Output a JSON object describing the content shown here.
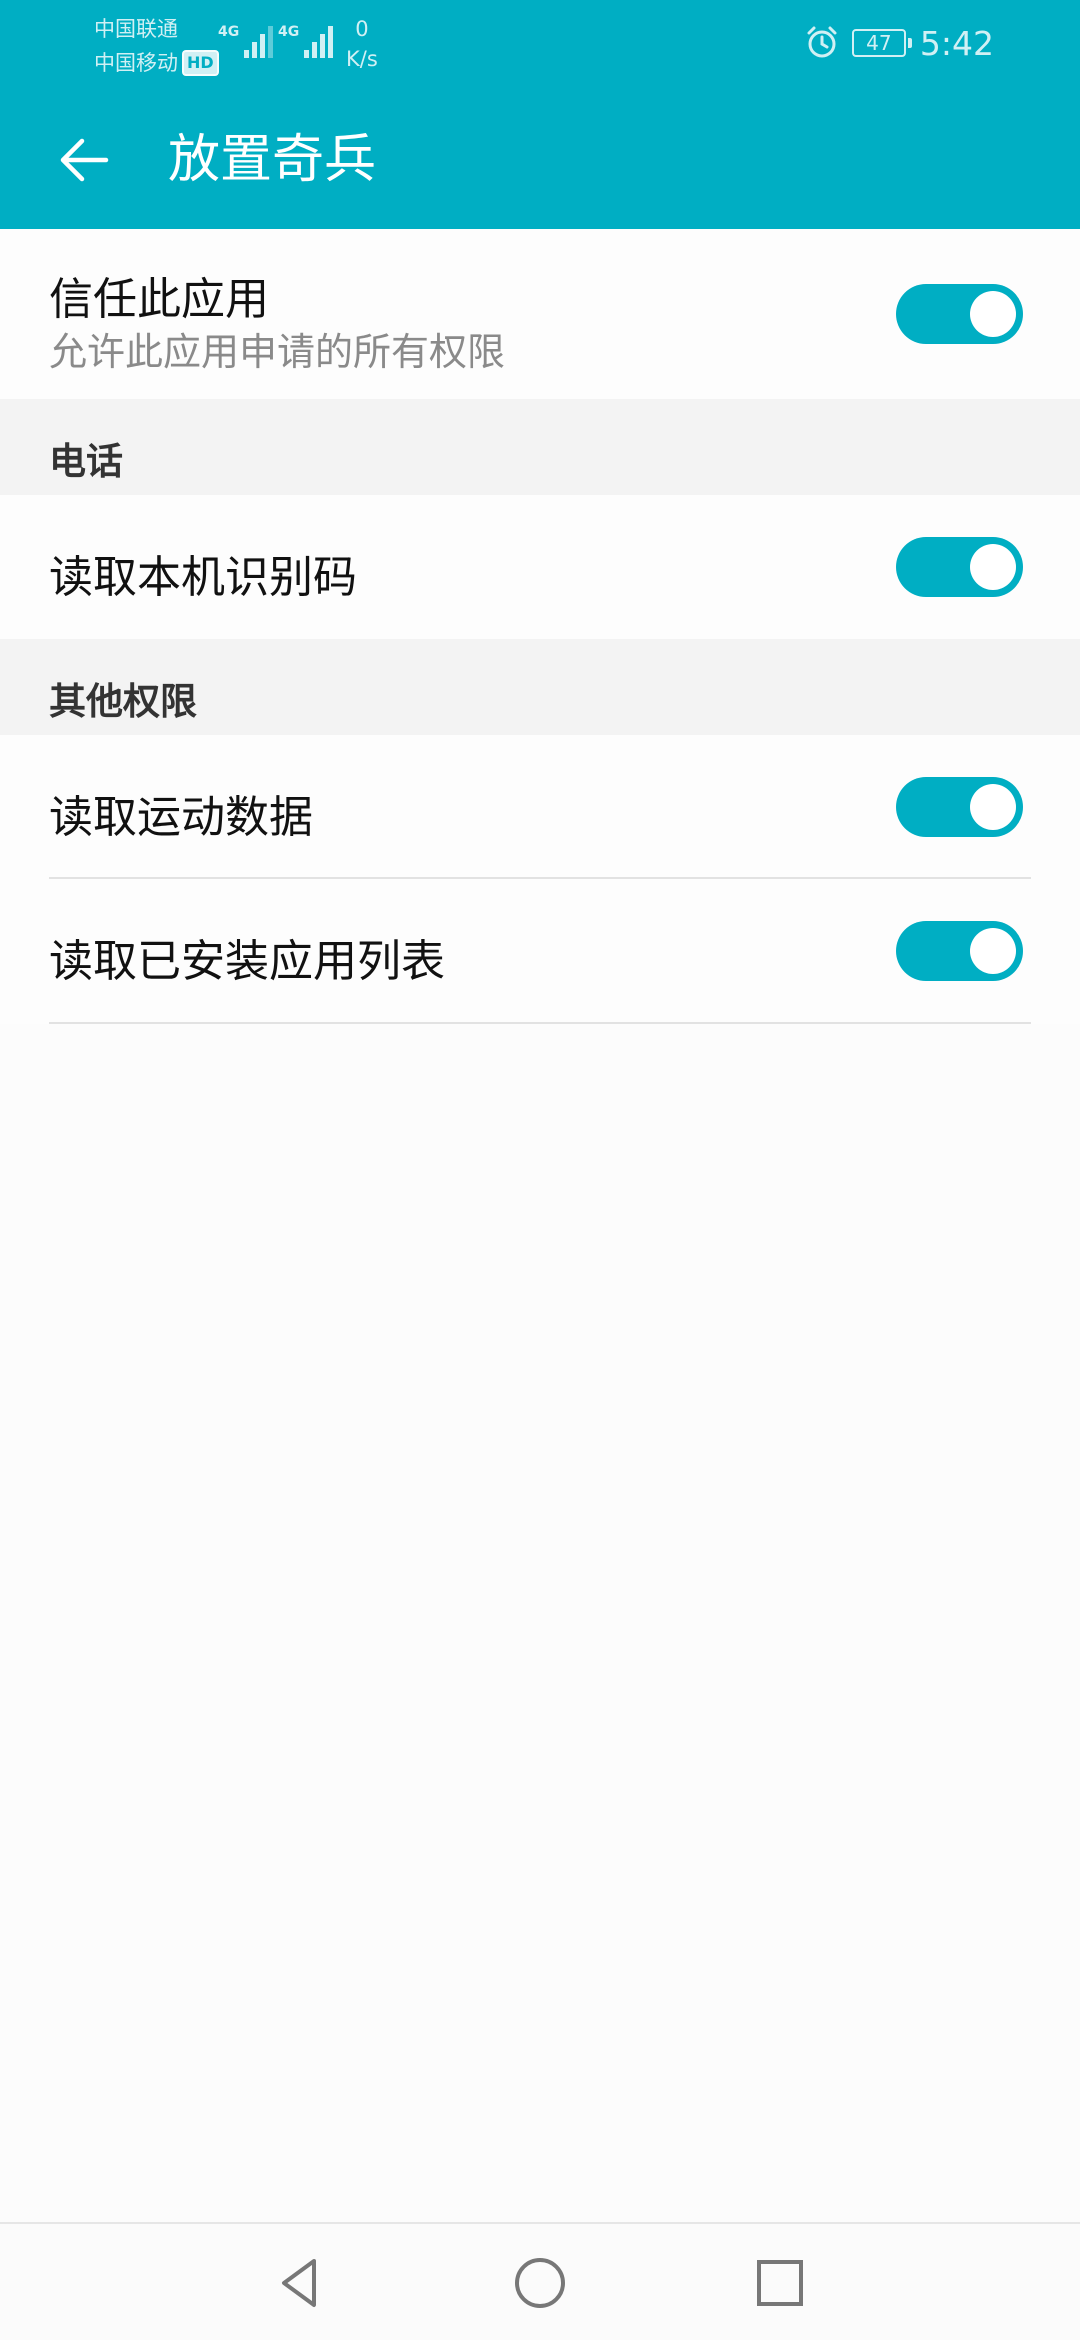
{
  "status_bar": {
    "carrier1": "中国联通",
    "carrier2": "中国移动",
    "hd_badge": "HD",
    "net1": "4G",
    "net2": "4G",
    "speed_value": "0",
    "speed_unit": "K/s",
    "battery": "47",
    "time": "5:42"
  },
  "app_bar": {
    "title": "放置奇兵",
    "back_icon": "arrow-left-icon"
  },
  "trust": {
    "label": "信任此应用",
    "sublabel": "允许此应用申请的所有权限",
    "enabled": true
  },
  "sections": {
    "phone": {
      "title": "电话",
      "items": [
        {
          "label": "读取本机识别码",
          "enabled": true
        }
      ]
    },
    "other": {
      "title": "其他权限",
      "items": [
        {
          "label": "读取运动数据",
          "enabled": true
        },
        {
          "label": "读取已安装应用列表",
          "enabled": true
        }
      ]
    }
  },
  "colors": {
    "accent": "#00aec3",
    "background": "#fcfcfc",
    "section_bg": "#f3f3f3"
  },
  "nav_bar": {
    "back": "triangle-back-icon",
    "home": "circle-home-icon",
    "recents": "square-recents-icon"
  }
}
